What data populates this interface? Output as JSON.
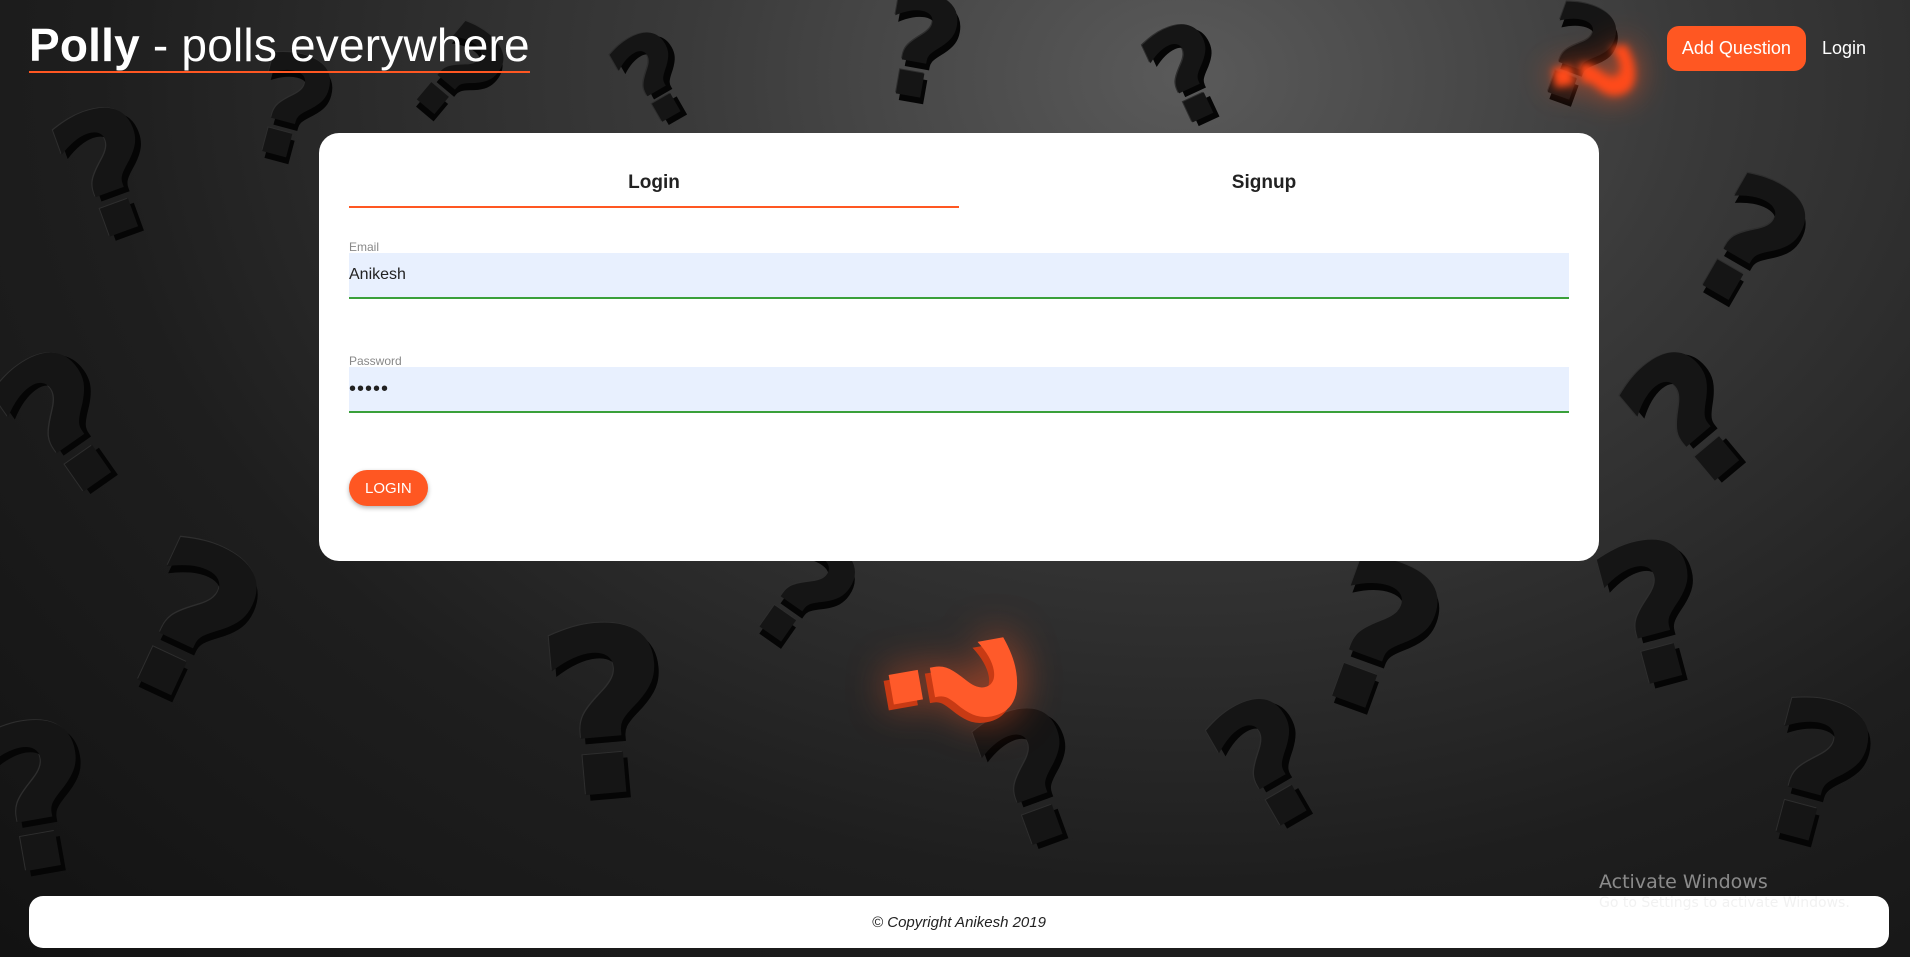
{
  "header": {
    "brand_name": "Polly",
    "brand_tagline": " - polls everywhere",
    "add_question_label": "Add Question",
    "login_label": "Login"
  },
  "auth_card": {
    "tabs": [
      {
        "label": "Login",
        "active": true
      },
      {
        "label": "Signup",
        "active": false
      }
    ],
    "email": {
      "label": "Email",
      "value": "Anikesh"
    },
    "password": {
      "label": "Password",
      "value": "•••••"
    },
    "submit_label": "LOGIN"
  },
  "footer": {
    "text": "© Copyright Anikesh 2019"
  },
  "watermark": {
    "title": "Activate Windows",
    "subtitle": "Go to Settings to activate Windows."
  },
  "colors": {
    "accent": "#ff5722",
    "input_bg": "#e8f0fe",
    "input_border": "#3aa03a",
    "card_bg": "#ffffff"
  }
}
